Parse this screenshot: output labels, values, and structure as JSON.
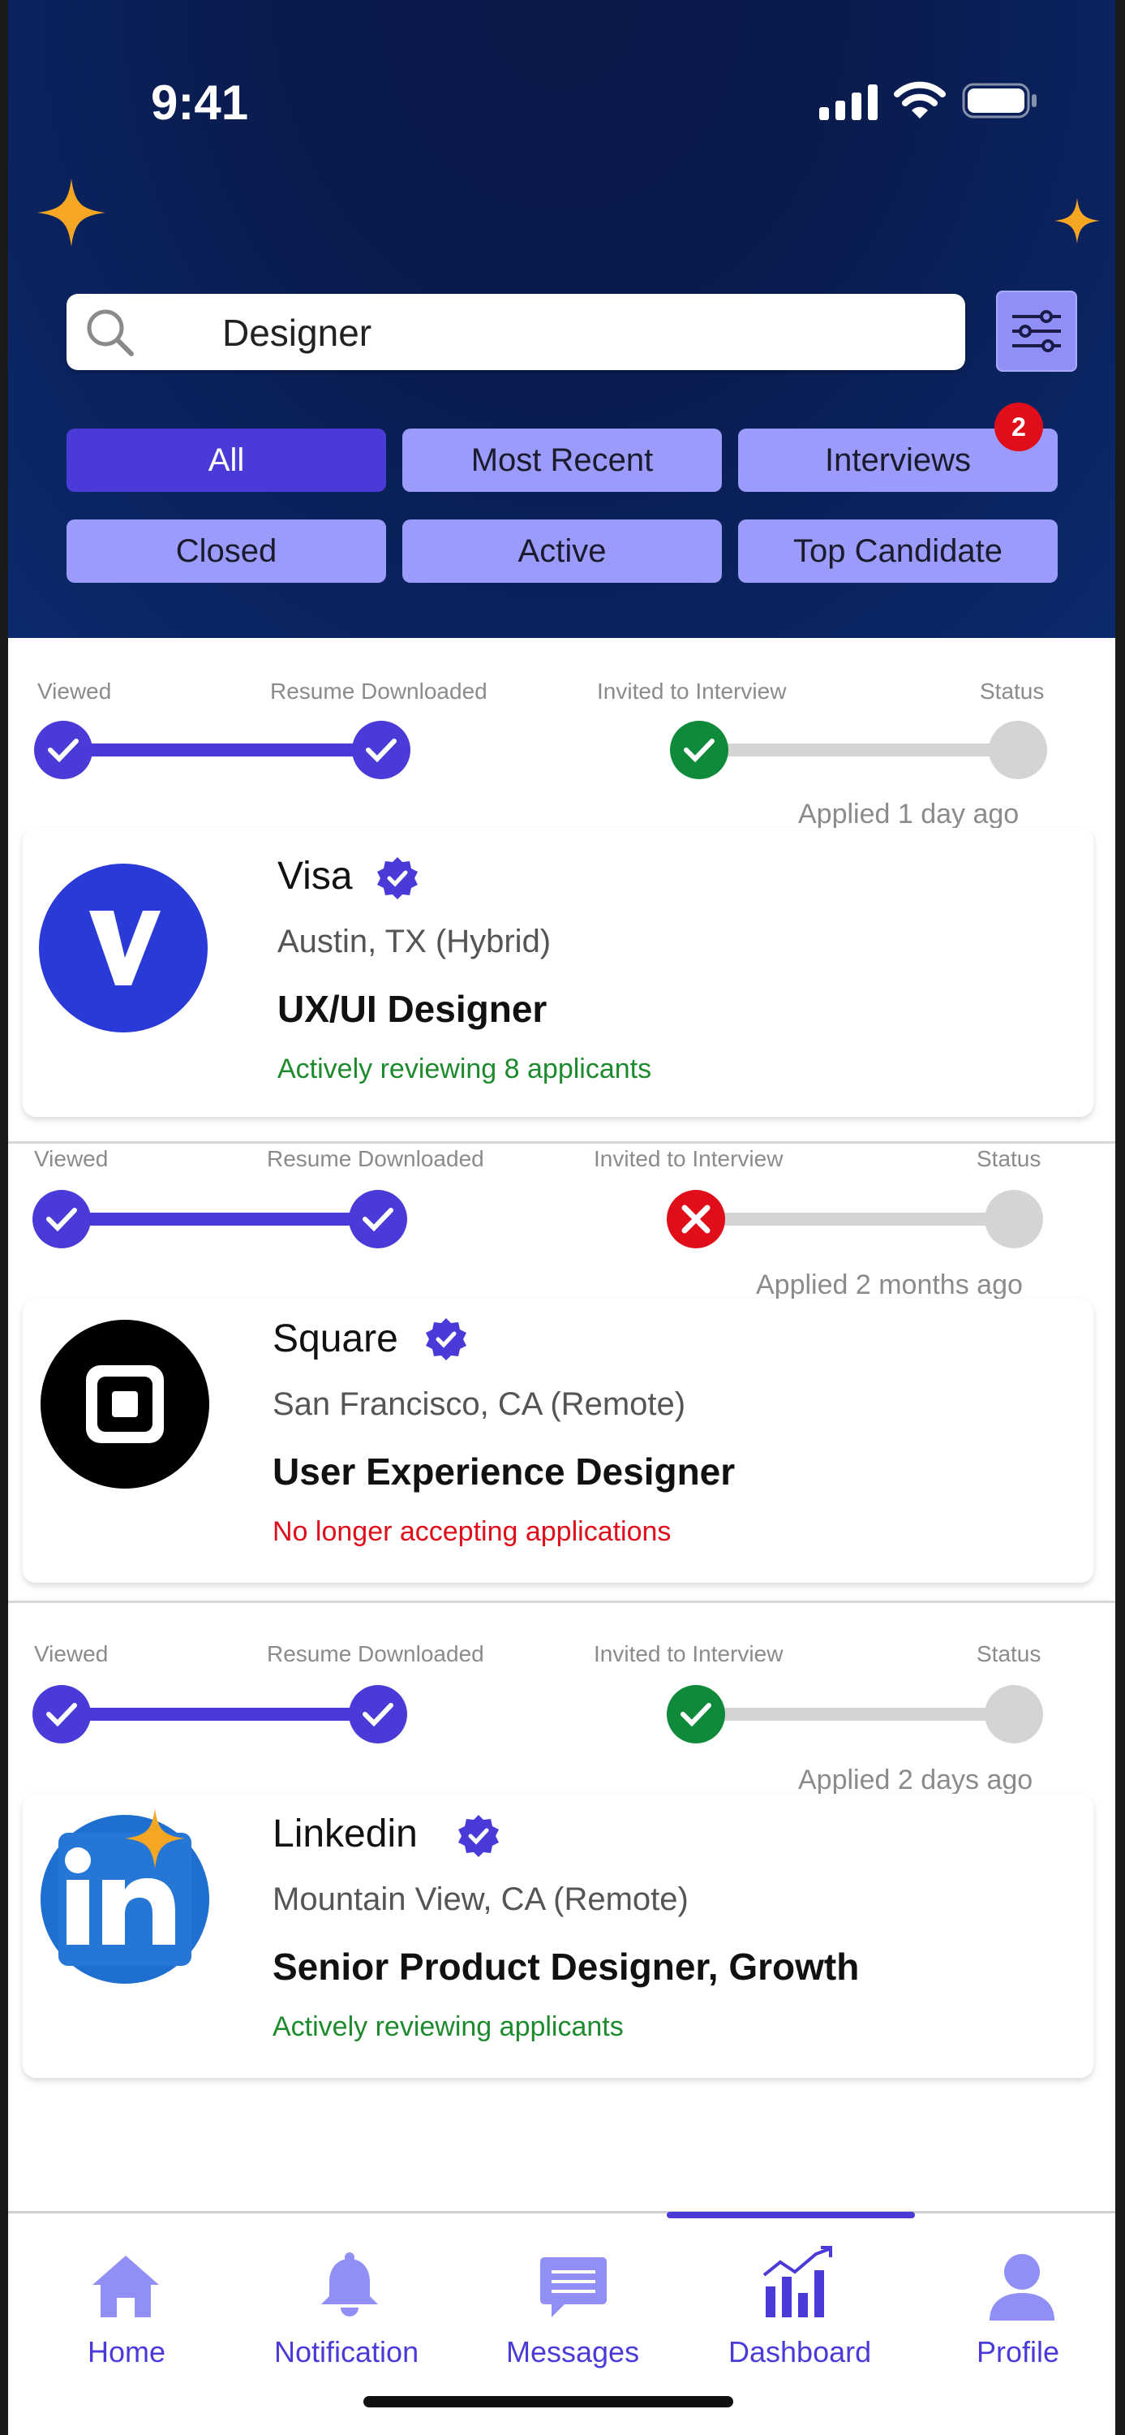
{
  "status_bar": {
    "time": "9:41"
  },
  "search": {
    "value": "Designer"
  },
  "filters": {
    "chips": [
      "All",
      "Most Recent",
      "Interviews",
      "Closed",
      "Active",
      "Top Candidate"
    ],
    "active": "All",
    "interviews_badge": "2"
  },
  "stages": [
    "Viewed",
    "Resume Downloaded",
    "Invited to Interview",
    "Status"
  ],
  "applications": [
    {
      "applied": "Applied 1 day ago",
      "company": "Visa",
      "location": "Austin, TX (Hybrid)",
      "role": "UX/UI Designer",
      "note": "Actively reviewing 8 applicants",
      "note_color": "#1e8a2e",
      "interview_status": "invited",
      "logo": "visa-logo"
    },
    {
      "applied": "Applied 2 months ago",
      "company": "Square",
      "location": "San Francisco, CA (Remote)",
      "role": "User Experience Designer",
      "note": "No longer accepting applications",
      "note_color": "#e00d1a",
      "interview_status": "rejected",
      "logo": "square-logo"
    },
    {
      "applied": "Applied 2 days ago",
      "company": "Linkedin",
      "location": "Mountain View, CA (Remote)",
      "role": "Senior Product Designer, Growth",
      "note": "Actively reviewing applicants",
      "note_color": "#1e8a2e",
      "interview_status": "invited",
      "logo": "linkedin-logo"
    }
  ],
  "nav": {
    "items": [
      "Home",
      "Notification",
      "Messages",
      "Dashboard",
      "Profile"
    ],
    "active": "Dashboard"
  },
  "colors": {
    "accent": "#4a3bd8",
    "chip": "#9b9bfb",
    "success": "#0f8a3a",
    "error": "#e00d1a",
    "hero": "#0b2a6e"
  }
}
